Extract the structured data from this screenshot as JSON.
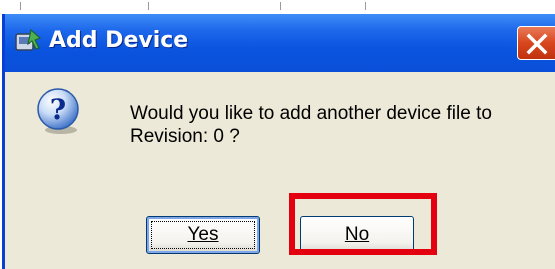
{
  "window": {
    "title": "Add Device",
    "app_icon": "add-device-icon",
    "close_icon": "close-icon",
    "accent_color": "#0a54df",
    "close_color": "#d8461d"
  },
  "dialog": {
    "icon": "question-icon",
    "message_line1": "Would you like to add another device file to",
    "message_line2": "Revision: 0 ?",
    "buttons": {
      "yes_label": "Yes",
      "no_label": "No"
    }
  },
  "annotation": {
    "highlight_color": "#e3000f",
    "highlighted": "no-button"
  }
}
